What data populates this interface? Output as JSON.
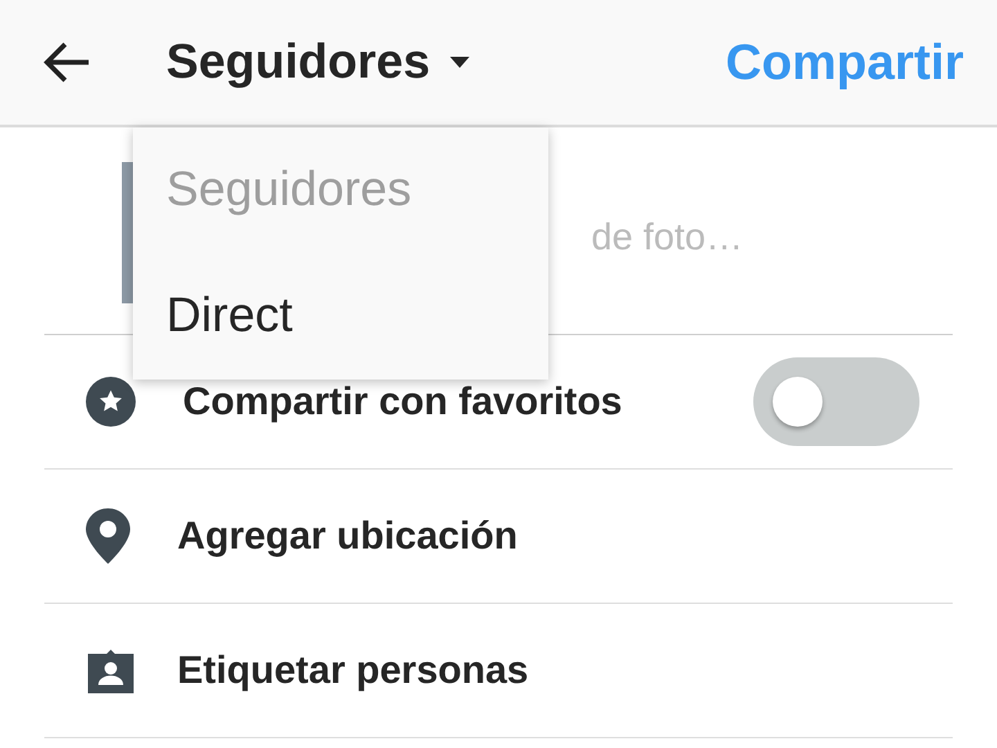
{
  "header": {
    "title": "Seguidores",
    "share": "Compartir"
  },
  "menu": {
    "items": [
      {
        "label": "Seguidores",
        "selected": true
      },
      {
        "label": "Direct",
        "selected": false
      }
    ]
  },
  "caption": {
    "placeholder": "de foto…"
  },
  "options": [
    {
      "kind": "star",
      "label": "Compartir con favoritos",
      "toggle": {
        "on": false
      }
    },
    {
      "kind": "pin",
      "label": "Agregar ubicación"
    },
    {
      "kind": "tag",
      "label": "Etiquetar personas"
    }
  ]
}
